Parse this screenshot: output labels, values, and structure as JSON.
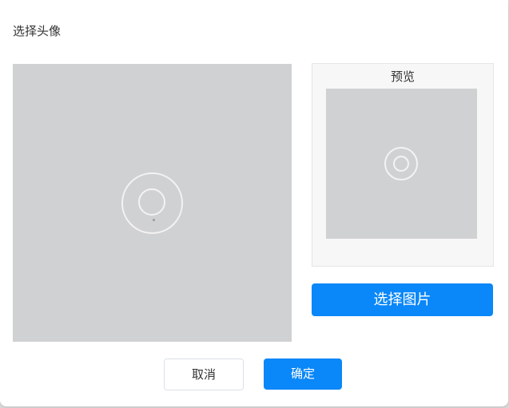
{
  "dialog": {
    "title": "选择头像"
  },
  "preview": {
    "label": "预览"
  },
  "buttons": {
    "select_image": "选择图片",
    "cancel": "取消",
    "confirm": "确定"
  },
  "colors": {
    "primary": "#0a87f8",
    "image_placeholder": "#d0d1d3"
  }
}
